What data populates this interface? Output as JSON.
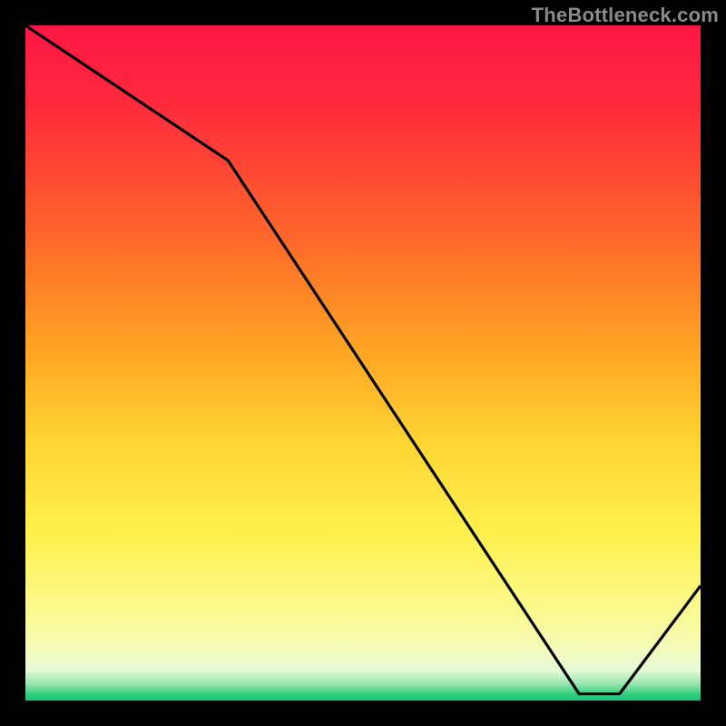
{
  "watermark": "TheBottleneck.com",
  "line_label": "",
  "chart_data": {
    "type": "line",
    "title": "",
    "xlabel": "",
    "ylabel": "",
    "xlim": [
      0,
      100
    ],
    "ylim": [
      0,
      100
    ],
    "series": [
      {
        "name": "curve",
        "x": [
          0,
          30,
          82,
          88,
          100
        ],
        "y": [
          100,
          80,
          1,
          1,
          17
        ]
      }
    ],
    "gradient_stops": [
      {
        "offset": 0.0,
        "color": "#ff1744"
      },
      {
        "offset": 0.12,
        "color": "#ff2a3c"
      },
      {
        "offset": 0.32,
        "color": "#ff6a2a"
      },
      {
        "offset": 0.48,
        "color": "#ffa424"
      },
      {
        "offset": 0.62,
        "color": "#ffd633"
      },
      {
        "offset": 0.75,
        "color": "#fff04d"
      },
      {
        "offset": 0.86,
        "color": "#fbf98a"
      },
      {
        "offset": 0.92,
        "color": "#f6fbb8"
      },
      {
        "offset": 0.955,
        "color": "#e6fbd8"
      },
      {
        "offset": 0.975,
        "color": "#98e6b0"
      },
      {
        "offset": 0.99,
        "color": "#35d080"
      },
      {
        "offset": 1.0,
        "color": "#18c47a"
      }
    ],
    "label_anchor": {
      "x": 85,
      "y": 2.2
    }
  }
}
